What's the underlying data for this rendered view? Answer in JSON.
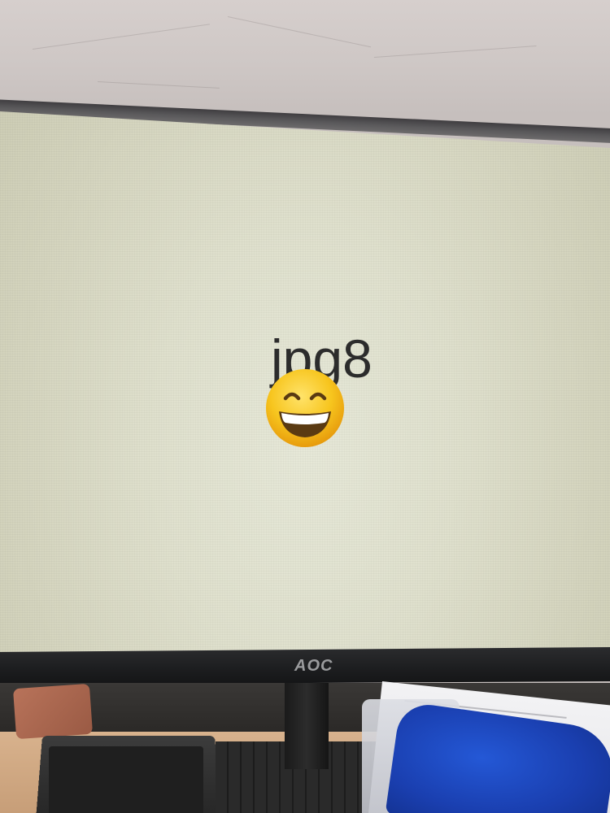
{
  "screen": {
    "text": "jpg8",
    "emoji": "grinning-face-with-smiling-eyes"
  },
  "monitor": {
    "brand": "AOC"
  },
  "colors": {
    "screen": "#dfe0cd",
    "bezel": "#1c1d1f",
    "emoji_face": "#f7c51e"
  }
}
